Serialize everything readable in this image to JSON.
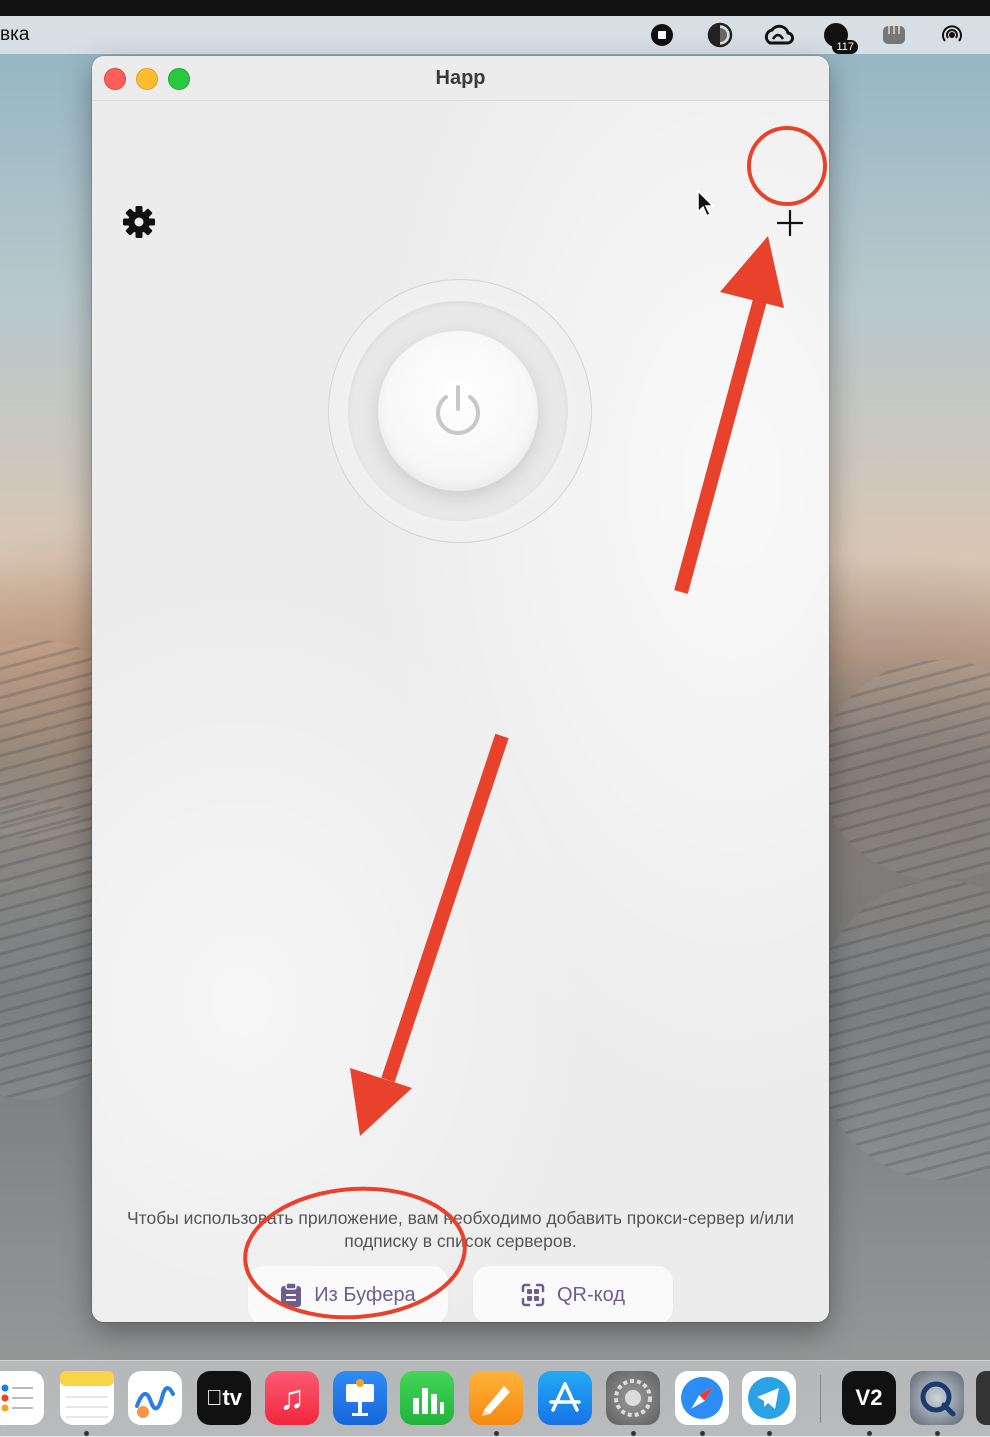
{
  "menubar": {
    "left_text": "вка",
    "icons": [
      "stop-record-icon",
      "contrast-icon",
      "creative-cloud-icon",
      "calendar-badge-icon",
      "fist-icon",
      "airdrop-icon"
    ],
    "badge_count": "117"
  },
  "window": {
    "title": "Happ"
  },
  "main": {
    "hint_text": "Чтобы использовать приложение, вам необходимо добавить прокси-сервер и/или подписку в список серверов.",
    "clipboard_button_label": "Из Буфера",
    "qr_button_label": "QR-код"
  },
  "dock": {
    "apps": [
      "reminders",
      "notes",
      "freeform",
      "apple-tv",
      "music",
      "keynote",
      "numbers",
      "pages",
      "app-store",
      "system-settings",
      "safari",
      "telegram",
      "v2box",
      "quicktime"
    ],
    "tv_label": "tv",
    "v2_label": "V2"
  },
  "annotations": {
    "color": "#e8412c"
  },
  "colors": {
    "accent_text": "#6c5f90",
    "traffic_red": "#fe5f57",
    "traffic_yellow": "#febc2e",
    "traffic_green": "#28c840"
  }
}
